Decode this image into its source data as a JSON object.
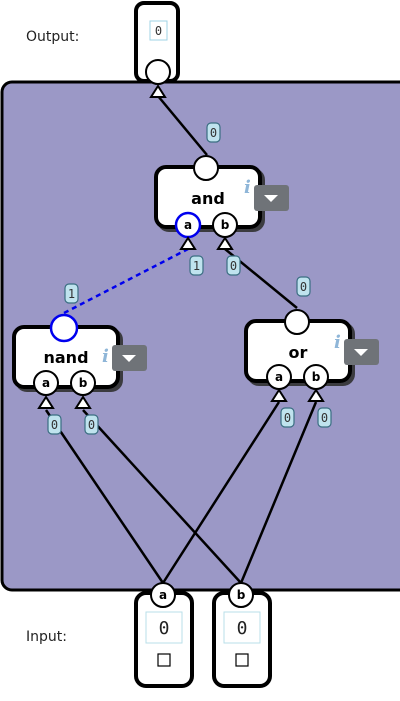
{
  "labels": {
    "output": "Output:",
    "input": "Input:"
  },
  "output": {
    "value": "0"
  },
  "inputs": [
    {
      "name": "a",
      "value": "0",
      "checked": false
    },
    {
      "name": "b",
      "value": "0",
      "checked": false
    }
  ],
  "gates": [
    {
      "id": "and",
      "title": "and",
      "ports": [
        "a",
        "b"
      ]
    },
    {
      "id": "nand",
      "title": "nand",
      "ports": [
        "a",
        "b"
      ]
    },
    {
      "id": "or",
      "title": "or",
      "ports": [
        "a",
        "b"
      ]
    }
  ],
  "wire_values": {
    "and_out": "0",
    "and_a_in": "1",
    "and_b_in": "0",
    "nand_out": "1",
    "or_out": "0",
    "nand_a_in": "0",
    "nand_b_in": "0",
    "or_a_in": "0",
    "or_b_in": "0"
  },
  "info_glyph": "i",
  "icons": [
    "dropdown-caret-icon",
    "info-icon",
    "checkbox-icon"
  ],
  "colors": {
    "panel": "#9b98c6",
    "active_wire": "#0000ee",
    "wire": "#000000",
    "value_badge": "#bfe3ee",
    "dropdown": "#6f7378"
  }
}
